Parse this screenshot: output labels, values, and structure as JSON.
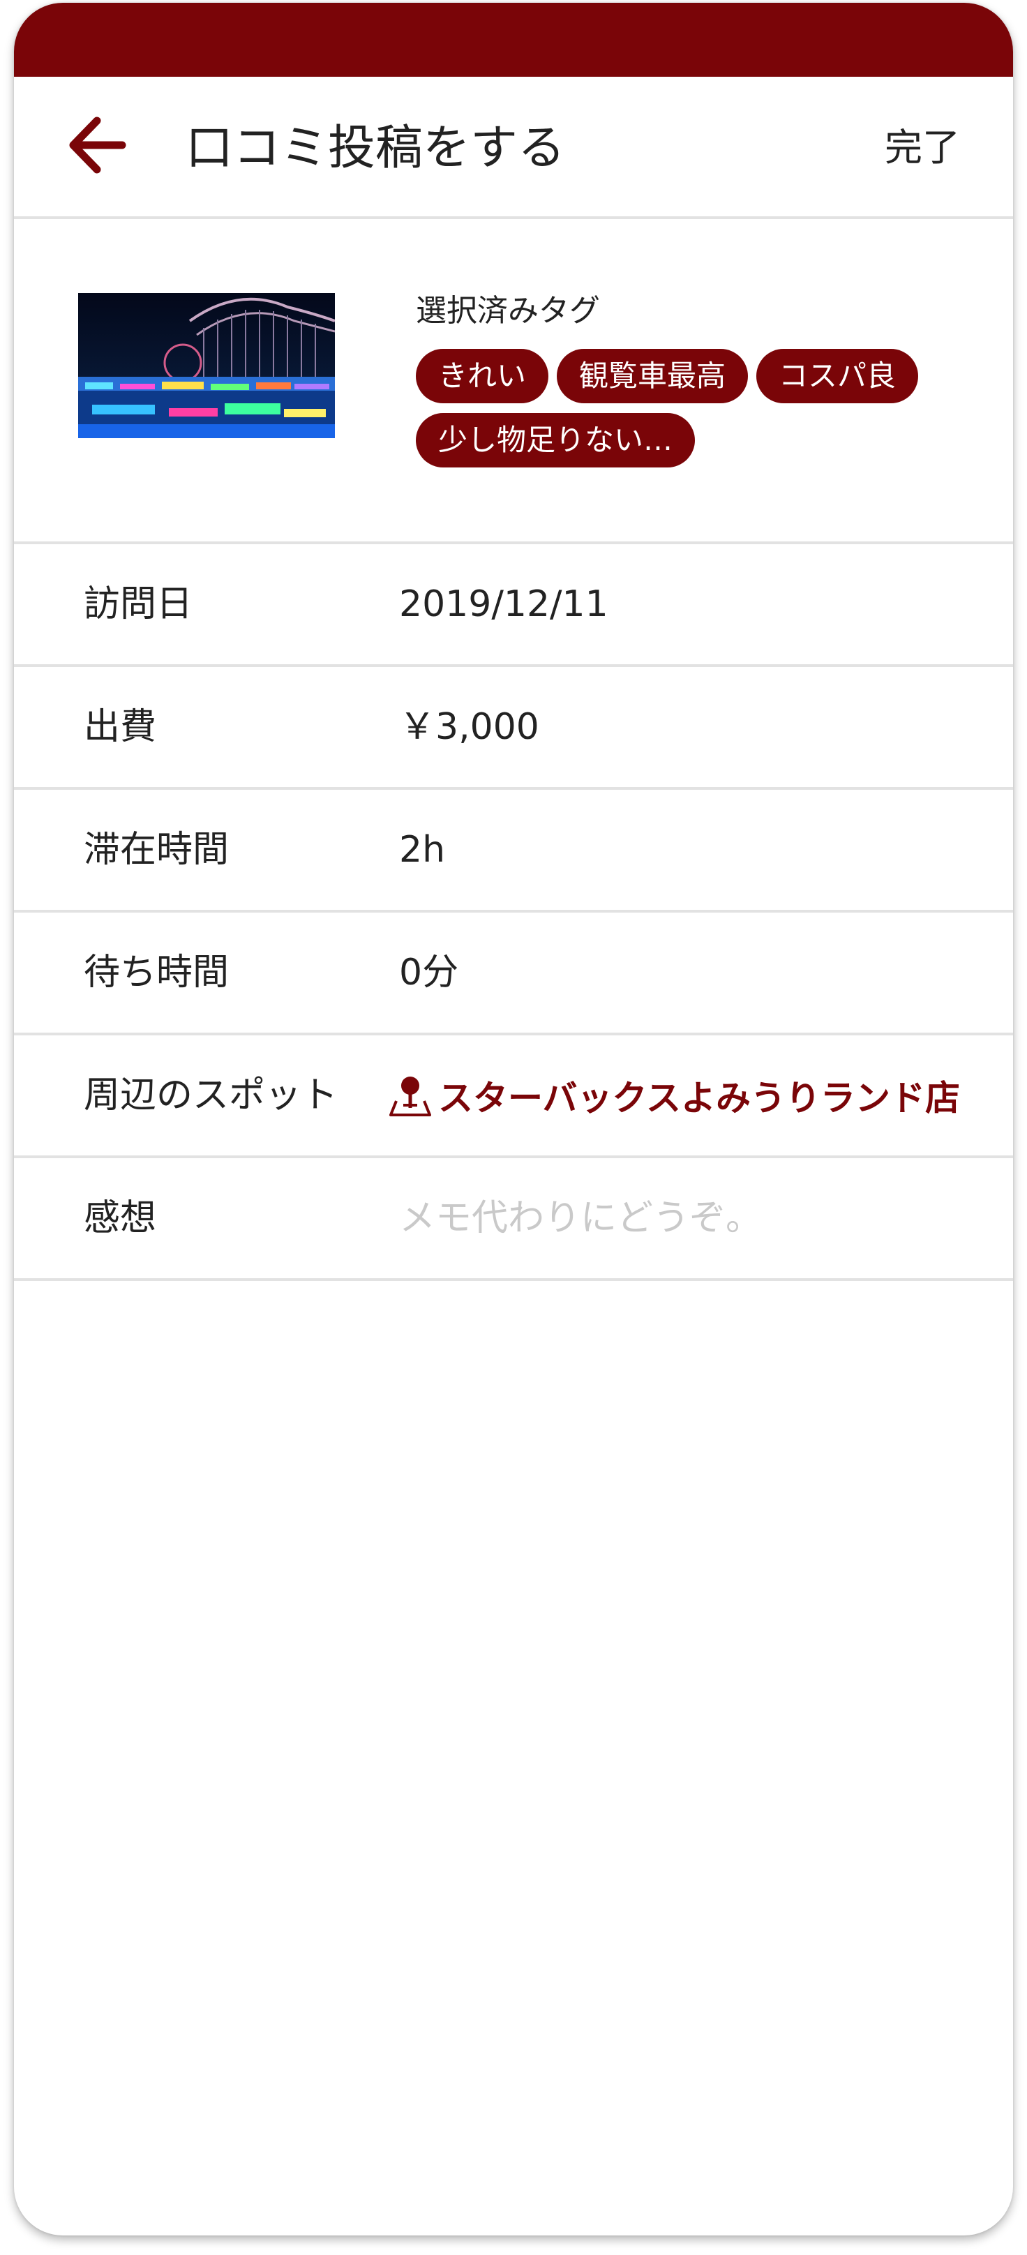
{
  "header": {
    "title": "口コミ投稿をする",
    "done_label": "完了",
    "accent_color": "#7a0508"
  },
  "summary": {
    "tags_title": "選択済みタグ",
    "tags": [
      "きれい",
      "観覧車最高",
      "コスパ良",
      "少し物足りない…"
    ]
  },
  "form": {
    "visit_date": {
      "label": "訪問日",
      "value": "2019/12/11"
    },
    "expense": {
      "label": "出費",
      "value": "￥3,000"
    },
    "stay_time": {
      "label": "滞在時間",
      "value": "2h"
    },
    "wait_time": {
      "label": "待ち時間",
      "value": "0分"
    },
    "nearby_spot": {
      "label": "周辺のスポット",
      "value": "スターバックスよみうりランド店",
      "icon": "map-pin-icon"
    },
    "impression": {
      "label": "感想",
      "placeholder": "メモ代わりにどうぞ。"
    }
  }
}
